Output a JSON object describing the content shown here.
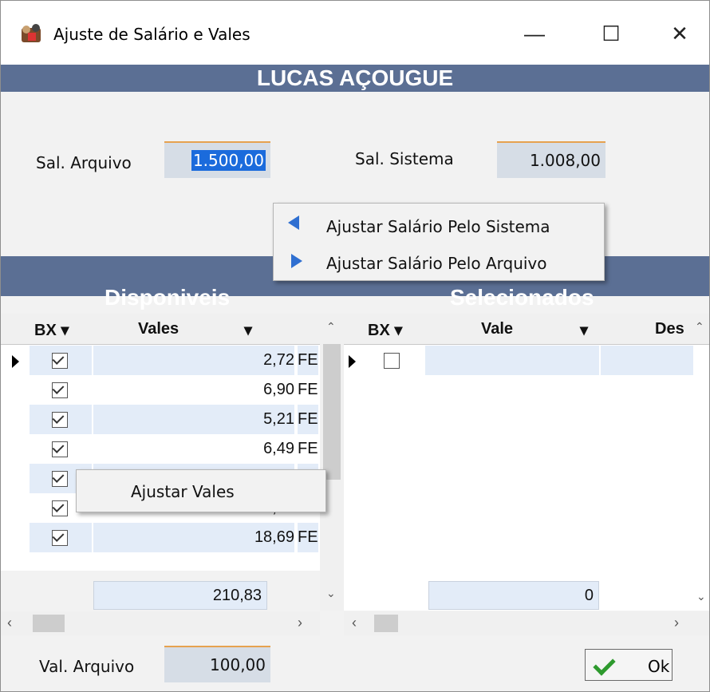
{
  "window": {
    "title": "Ajuste de Salário e Vales",
    "minimize_glyph": "—",
    "maximize_glyph": "☐",
    "close_glyph": "✕",
    "app_icon": "app-icon"
  },
  "header": {
    "title": "LUCAS AÇOUGUE"
  },
  "salary": {
    "arquivo_label": "Sal. Arquivo",
    "arquivo_value": "1.500,00",
    "sistema_label": "Sal. Sistema",
    "sistema_value": "1.008,00"
  },
  "salary_menu": {
    "items": [
      {
        "label": "Ajustar Salário Pelo Sistema",
        "icon": "arrow-left-icon"
      },
      {
        "label": "Ajustar Salário Pelo Arquivo",
        "icon": "arrow-right-icon"
      }
    ]
  },
  "disponiveis": {
    "title": "Disponiveis",
    "columns": {
      "bx": "BX",
      "vales": "Vales"
    },
    "rows": [
      {
        "checked": true,
        "value": "2,72",
        "desc": "FECI"
      },
      {
        "checked": true,
        "value": "6,90",
        "desc": "FECI"
      },
      {
        "checked": true,
        "value": "5,21",
        "desc": "FECI"
      },
      {
        "checked": true,
        "value": "6,49",
        "desc": "FECI"
      },
      {
        "checked": true,
        "value": "",
        "desc": ""
      },
      {
        "checked": true,
        "value": "127,83",
        "desc": "FECI"
      },
      {
        "checked": true,
        "value": "18,69",
        "desc": "FECI"
      }
    ],
    "total": "210,83"
  },
  "vales_menu": {
    "items": [
      {
        "label": "Ajustar Vales"
      }
    ]
  },
  "selecionados": {
    "title": "Selecionados",
    "columns": {
      "bx": "BX",
      "vale": "Vale",
      "des": "Des"
    },
    "rows": [
      {
        "checked": false
      }
    ],
    "total": "0"
  },
  "footer": {
    "val_arquivo_label": "Val. Arquivo",
    "val_arquivo_value": "100,00",
    "ok_label": "Ok"
  },
  "colors": {
    "header_band": "#5b6f94",
    "field_bg": "#d6dde6",
    "field_accent": "#e6a24f",
    "row_alt": "#e3ecf8",
    "selection": "#1b6bdc",
    "menu_arrow": "#2f6fd1",
    "ok_check": "#2e9a2e"
  }
}
